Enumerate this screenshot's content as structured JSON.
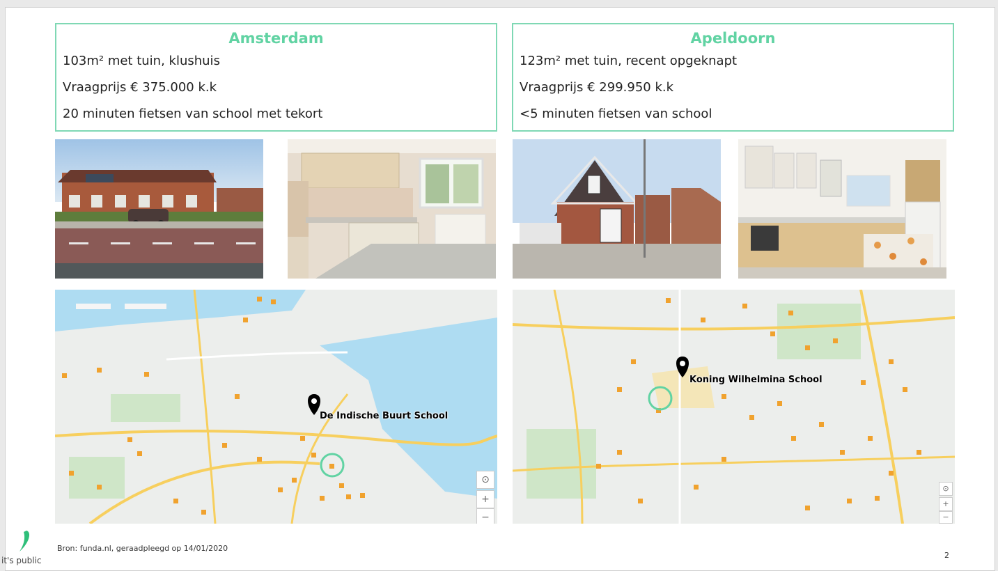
{
  "left": {
    "city": "Amsterdam",
    "line1": "103m² met tuin, klushuis",
    "line2": "Vraagprijs € 375.000 k.k",
    "line3": "20 minuten fietsen van school met tekort",
    "map_marker_label": "De Indische Buurt School"
  },
  "right": {
    "city": "Apeldoorn",
    "line1": "123m² met tuin, recent opgeknapt",
    "line2": "Vraagprijs € 299.950 k.k",
    "line3": "<5 minuten fietsen van school",
    "map_marker_label": "Koning Wilhelmina School"
  },
  "footer": {
    "source": "Bron: funda.nl, geraadpleegd op 14/01/2020",
    "page_number": "2",
    "logo_text": "it's public"
  },
  "colors": {
    "accent": "#61d3a3",
    "border": "#7fd8b4",
    "poi": "#f0a22e"
  }
}
